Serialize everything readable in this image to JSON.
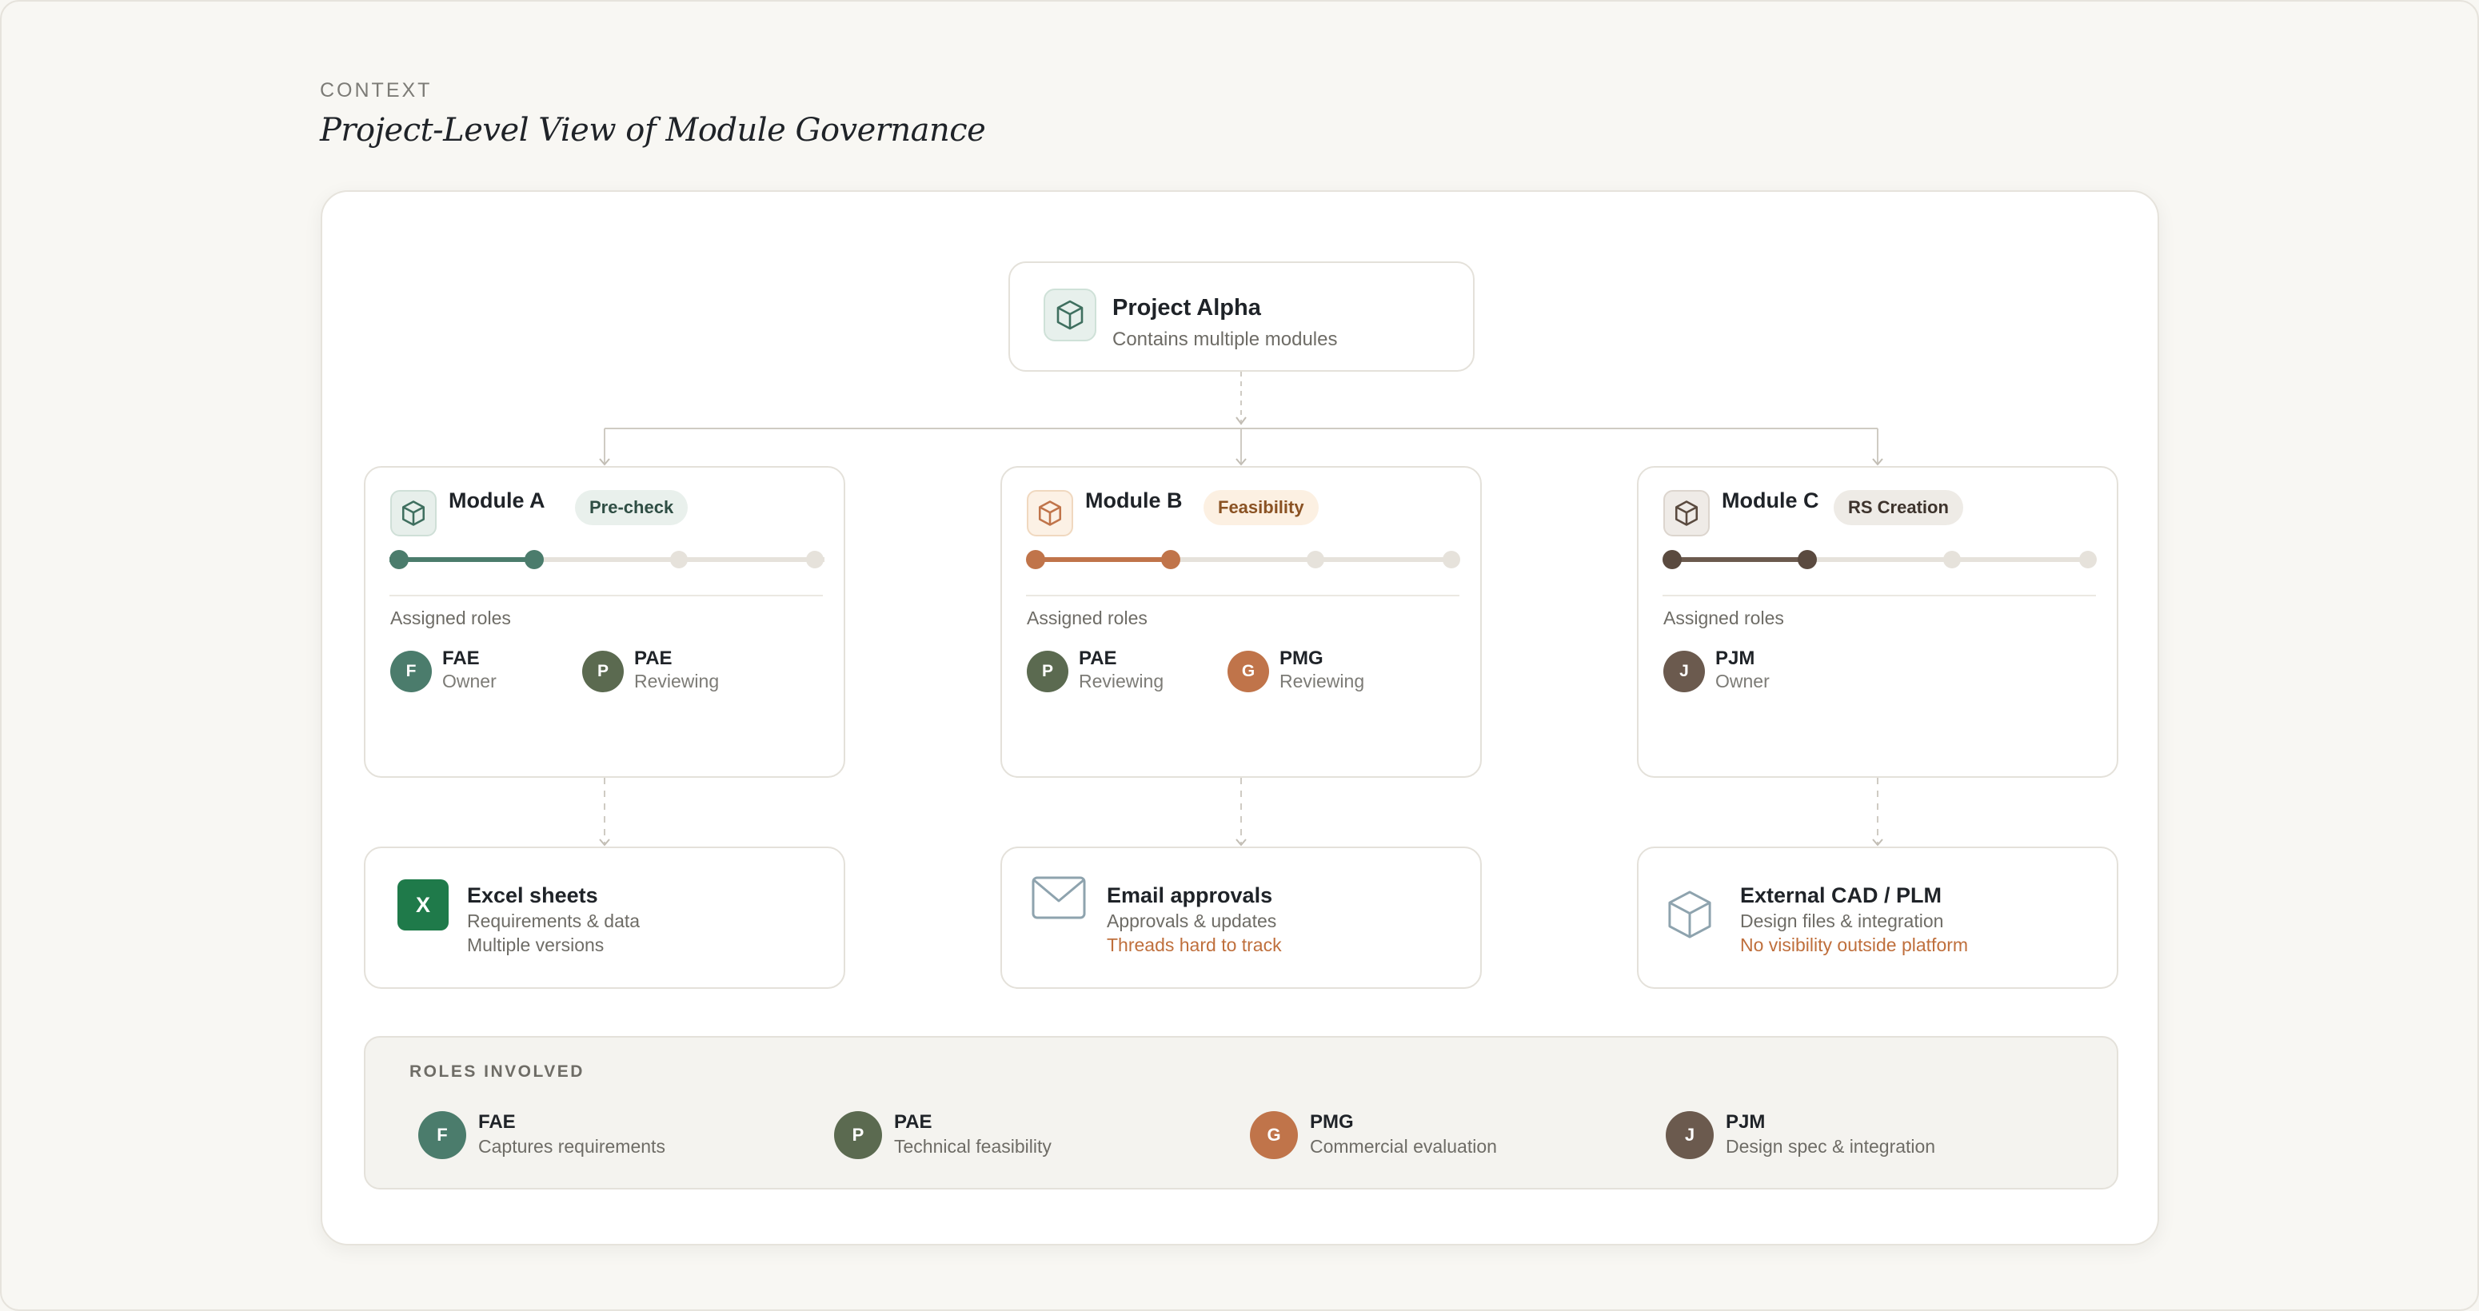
{
  "header": {
    "eyebrow": "CONTEXT",
    "title": "Project-Level View of Module Governance"
  },
  "project": {
    "title": "Project Alpha",
    "subtitle": "Contains multiple modules",
    "icon": "cube-icon"
  },
  "modules": [
    {
      "title": "Module A",
      "stage": "Pre-check",
      "progress_step": 2,
      "total_steps": 4,
      "accent": "#4b7c6c",
      "badge_bg": "#e9f0ec",
      "badge_fg": "#2f4e44",
      "assigned_label": "Assigned roles",
      "roles": [
        {
          "initial": "F",
          "name": "FAE",
          "state": "Owner",
          "color": "#4b7c6c"
        },
        {
          "initial": "P",
          "name": "PAE",
          "state": "Reviewing",
          "color": "#5b6a50"
        }
      ]
    },
    {
      "title": "Module B",
      "stage": "Feasibility",
      "progress_step": 2,
      "total_steps": 4,
      "accent": "#c0744a",
      "badge_bg": "#fcf0e2",
      "badge_fg": "#8a5223",
      "assigned_label": "Assigned roles",
      "roles": [
        {
          "initial": "P",
          "name": "PAE",
          "state": "Reviewing",
          "color": "#5b6a50"
        },
        {
          "initial": "G",
          "name": "PMG",
          "state": "Reviewing",
          "color": "#c0744a"
        }
      ]
    },
    {
      "title": "Module C",
      "stage": "RS Creation",
      "progress_step": 2,
      "total_steps": 4,
      "accent": "#6b5a4e",
      "badge_bg": "#eeebe6",
      "badge_fg": "#3d332c",
      "assigned_label": "Assigned roles",
      "roles": [
        {
          "initial": "J",
          "name": "PJM",
          "state": "Owner",
          "color": "#6b5a4e"
        }
      ]
    }
  ],
  "tools": [
    {
      "title": "Excel sheets",
      "line1": "Requirements & data",
      "line2": "Multiple versions",
      "icon": "excel-icon",
      "icon_label": "X"
    },
    {
      "title": "Email approvals",
      "line1": "Approvals & updates",
      "line2": "Threads hard to track",
      "icon": "envelope-icon"
    },
    {
      "title": "External CAD / PLM",
      "line1": "Design files & integration",
      "line2": "No visibility outside platform",
      "icon": "cube-outline-icon"
    }
  ],
  "roles_involved": {
    "label": "ROLES INVOLVED",
    "roles": [
      {
        "initial": "F",
        "name": "FAE",
        "desc": "Captures requirements",
        "color": "#4b7c6c"
      },
      {
        "initial": "P",
        "name": "PAE",
        "desc": "Technical feasibility",
        "color": "#5b6a50"
      },
      {
        "initial": "G",
        "name": "PMG",
        "desc": "Commercial evaluation",
        "color": "#c0744a"
      },
      {
        "initial": "J",
        "name": "PJM",
        "desc": "Design spec & integration",
        "color": "#6b5a4e"
      }
    ]
  },
  "colors": {
    "warning_text": "#bf6f3c",
    "excel_green": "#1f7a4a",
    "track_empty": "#e6e2db"
  }
}
